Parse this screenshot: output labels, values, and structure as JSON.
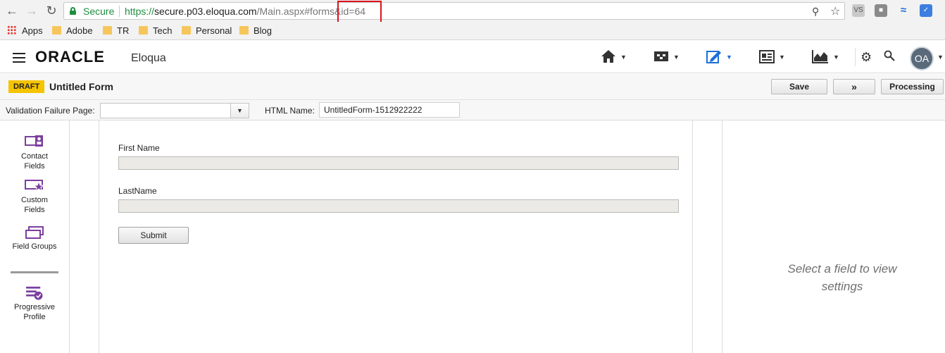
{
  "browser": {
    "secure_label": "Secure",
    "url_scheme": "https://",
    "url_host": "secure.p03.eloqua.com",
    "url_path": "/Main.aspx#forms&id=64",
    "bookmarks": {
      "apps": "Apps",
      "adobe": "Adobe",
      "tr": "TR",
      "tech": "Tech",
      "personal": "Personal",
      "blog": "Blog"
    }
  },
  "header": {
    "brand": "ORACLE",
    "product": "Eloqua",
    "avatar_initials": "OA",
    "nav_icons": [
      "home-icon",
      "orchestration-icon",
      "assets-icon",
      "contacts-icon",
      "insight-icon"
    ],
    "accent_color": "#1c6fd6"
  },
  "titlebar": {
    "status_badge": "DRAFT",
    "title": "Untitled Form",
    "save_label": "Save",
    "more_label": "»",
    "processing_label": "Processing"
  },
  "settings": {
    "validation_failure_label": "Validation Failure Page:",
    "validation_failure_value": "",
    "html_name_label": "HTML Name:",
    "html_name_value": "UntitledForm-1512922222"
  },
  "palette": {
    "contact_fields": [
      "Contact",
      "Fields"
    ],
    "custom_fields": [
      "Custom",
      "Fields"
    ],
    "field_groups": "Field Groups",
    "progressive_profile": [
      "Progressive",
      "Profile"
    ]
  },
  "form": {
    "fields": [
      {
        "label": "First Name",
        "value": ""
      },
      {
        "label": "LastName",
        "value": ""
      }
    ],
    "submit_label": "Submit"
  },
  "right_panel": {
    "message_line1": "Select a field to view",
    "message_line2": "settings"
  }
}
